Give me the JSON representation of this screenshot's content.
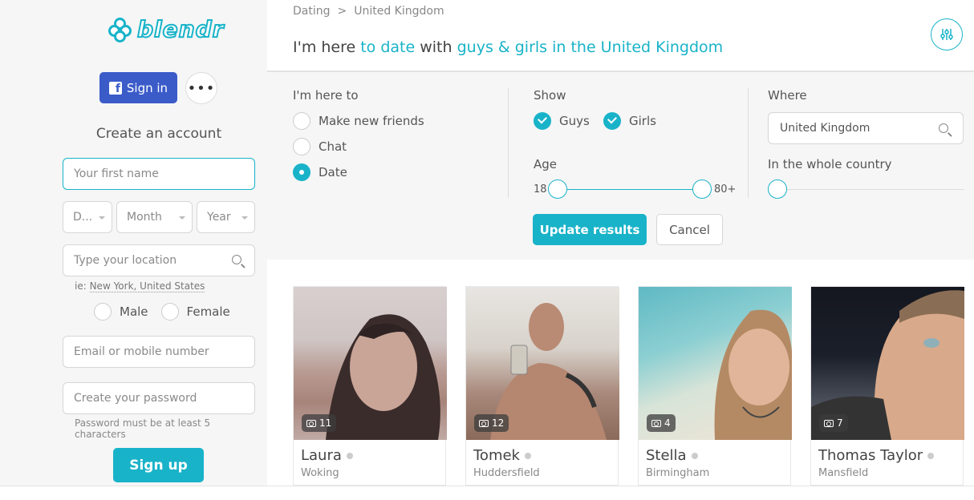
{
  "sidebar": {
    "logo_text": "blendr",
    "fb_button": "Sign in",
    "more_button": "•••",
    "create_title": "Create an account",
    "first_name_placeholder": "Your first name",
    "day_placeholder": "D...",
    "month_placeholder": "Month",
    "year_placeholder": "Year",
    "location_placeholder": "Type your location",
    "location_hint_prefix": "ie: ",
    "location_hint": "New York, United States",
    "gender_male": "Male",
    "gender_female": "Female",
    "email_placeholder": "Email or mobile number",
    "password_placeholder": "Create your password",
    "password_note": "Password must be at least 5 characters",
    "signup_button": "Sign up"
  },
  "breadcrumb": [
    "Dating",
    ">",
    "United Kingdom"
  ],
  "headline": {
    "prefix": "I'm here ",
    "purpose": "to date",
    "middle": " with ",
    "who": "guys & girls in the United Kingdom"
  },
  "filters": {
    "here_to_label": "I'm here to",
    "options": [
      {
        "label": "Make new friends",
        "checked": false
      },
      {
        "label": "Chat",
        "checked": false
      },
      {
        "label": "Date",
        "checked": true
      }
    ],
    "show_label": "Show",
    "show_guys": "Guys",
    "show_girls": "Girls",
    "age_label": "Age",
    "age_min": "18",
    "age_max": "80+",
    "where_label": "Where",
    "where_value": "United Kingdom",
    "distance_label": "In the whole country",
    "update_button": "Update results",
    "cancel_button": "Cancel"
  },
  "profiles": [
    {
      "name": "Laura",
      "city": "Woking",
      "photos": "11"
    },
    {
      "name": "Tomek",
      "city": "Huddersfield",
      "photos": "12"
    },
    {
      "name": "Stella",
      "city": "Birmingham",
      "photos": "4"
    },
    {
      "name": "Thomas Taylor",
      "city": "Mansfield",
      "photos": "7"
    }
  ],
  "colors": {
    "accent": "#19b3c9",
    "facebook": "#3b5bc9"
  }
}
